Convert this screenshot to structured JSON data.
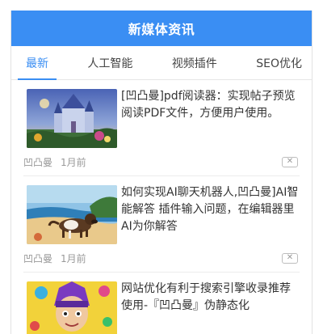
{
  "header": {
    "title": "新媒体资讯"
  },
  "tabs": [
    {
      "label": "最新",
      "active": true
    },
    {
      "label": "人工智能",
      "active": false
    },
    {
      "label": "视频插件",
      "active": false
    },
    {
      "label": "SEO优化",
      "active": false
    }
  ],
  "articles": [
    {
      "title": "[凹凸曼]pdf阅读器：实现帖子预览阅读PDF文件，方便用户使用。",
      "author": "凹凸曼",
      "time": "1月前",
      "close_icon": "close-x-icon",
      "thumb_icon": "castle-painting"
    },
    {
      "title": "如何实现AI聊天机器人,凹凸曼]AI智能解答 插件输入问题，在编辑器里AI为你解答",
      "author": "凹凸曼",
      "time": "1月前",
      "close_icon": "close-x-icon",
      "thumb_icon": "dog-on-beach-painting"
    },
    {
      "title": "网站优化有利于搜索引擎收录推荐使用-『凹凸曼』伪静态化",
      "author": "",
      "time": "",
      "close_icon": "",
      "thumb_icon": "cartoon-character-illustration"
    }
  ],
  "colors": {
    "accent": "#3a8ef3"
  }
}
